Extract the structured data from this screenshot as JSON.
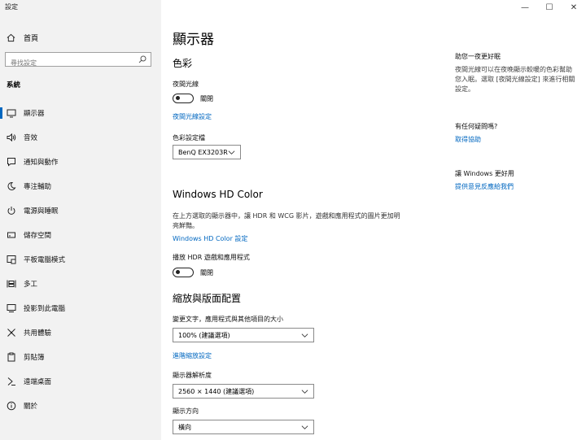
{
  "app": {
    "title": "設定"
  },
  "window_controls": {
    "minimize": "—",
    "maximize": "☐",
    "close": "✕"
  },
  "sidebar": {
    "home_label": "首頁",
    "search_placeholder": "尋找設定",
    "section_label": "系統",
    "items": [
      {
        "label": "顯示器",
        "icon": "monitor-icon",
        "active": true
      },
      {
        "label": "音效",
        "icon": "speaker-icon"
      },
      {
        "label": "通知與動作",
        "icon": "notification-icon"
      },
      {
        "label": "專注輔助",
        "icon": "moon-icon"
      },
      {
        "label": "電源與睡眠",
        "icon": "power-icon"
      },
      {
        "label": "儲存空間",
        "icon": "storage-icon"
      },
      {
        "label": "平板電腦模式",
        "icon": "tablet-icon"
      },
      {
        "label": "多工",
        "icon": "multitask-icon"
      },
      {
        "label": "投影到此電腦",
        "icon": "project-icon"
      },
      {
        "label": "共用體驗",
        "icon": "share-icon"
      },
      {
        "label": "剪貼簿",
        "icon": "clipboard-icon"
      },
      {
        "label": "遠端桌面",
        "icon": "remote-icon"
      },
      {
        "label": "關於",
        "icon": "info-icon"
      }
    ]
  },
  "main": {
    "title": "顯示器",
    "color_section": {
      "heading": "色彩",
      "night_light_label": "夜間光線",
      "night_light_state": "關閉",
      "night_light_link": "夜間光線設定",
      "color_profile_label": "色彩設定檔",
      "color_profile_value": "BenQ EX3203R"
    },
    "hdr_section": {
      "heading": "Windows HD Color",
      "description": "在上方選取的顯示器中，讓 HDR 和 WCG 影片，遊戲和應用程式的圖片更加明亮鮮豔。",
      "link": "Windows HD Color 設定",
      "play_hdr_label": "播放 HDR 遊戲和應用程式",
      "play_hdr_state": "關閉"
    },
    "scale_section": {
      "heading": "縮放與版面配置",
      "scale_label": "變更文字，應用程式與其他項目的大小",
      "scale_value": "100% (建議選項)",
      "advanced_link": "進階縮放設定",
      "resolution_label": "顯示器解析度",
      "resolution_value": "2560 × 1440 (建議選項)",
      "orientation_label": "顯示方向",
      "orientation_value": "橫向"
    }
  },
  "right_panel": {
    "sleep_heading": "助您一夜更好眠",
    "sleep_text": "夜間光線可以在夜晚顯示較暖的色彩幫助您入眠。選取 [夜間光線設定] 來進行相關設定。",
    "help_heading": "有任何疑問嗎?",
    "help_link": "取得協助",
    "improve_heading": "讓 Windows 更好用",
    "improve_link": "提供意見反應給我們"
  },
  "colors": {
    "accent": "#0067c0",
    "sidebar_bg": "#f2f2f2"
  }
}
